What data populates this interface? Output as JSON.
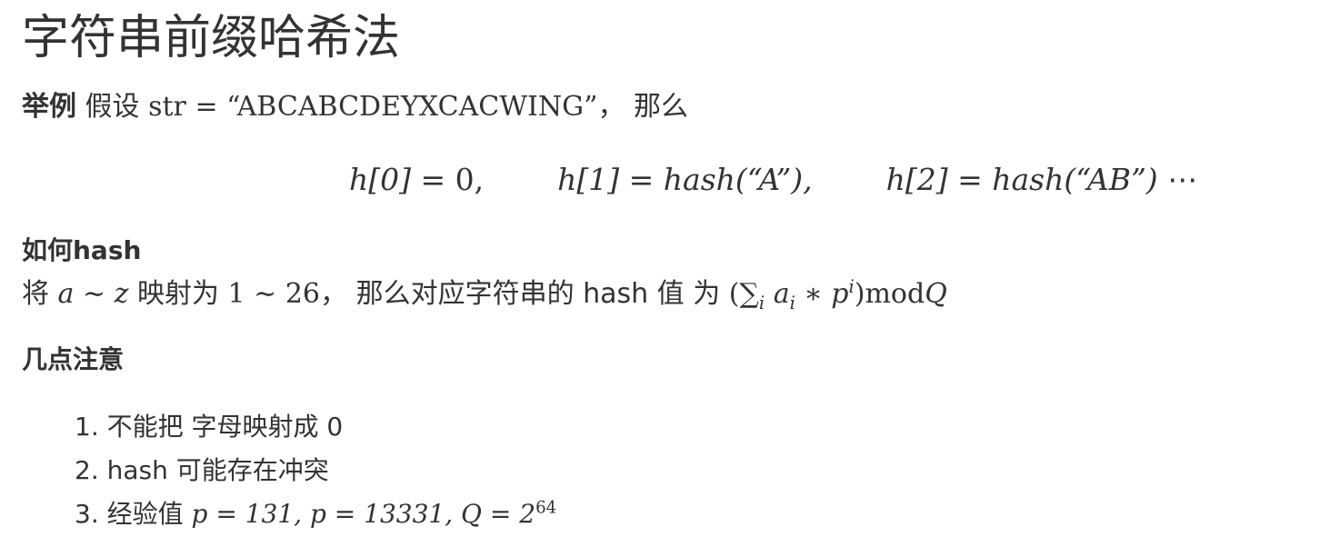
{
  "title": "字符串前缀哈希法",
  "example": {
    "label": "举例",
    "prefix": "假设",
    "var": "str",
    "eq": "=",
    "value": "“ABCABCDEYXCACWING”",
    "suffix": "， 那么"
  },
  "display_math": {
    "h0_lhs": "h[0]",
    "h0_rhs": "= 0,",
    "h1_lhs": "h[1]",
    "h1_rhs": "= hash(“A”),",
    "h2_lhs": "h[2]",
    "h2_rhs": "= hash(“AB”)",
    "dots": "⋯"
  },
  "how_hash": {
    "heading": "如何hash",
    "jiang": "将",
    "range_letters": "a ∼ z",
    "map_to": "映射为",
    "range_nums": "1 ∼ 26",
    "text_mid": "， 那么对应字符串的 hash 值 为",
    "formula_open": "(",
    "sum": "∑",
    "sum_sub": "i",
    "a": "a",
    "a_sub": "i",
    "times_p": " ∗ p",
    "p_sup": "i",
    "formula_close": ")",
    "mod": "mod",
    "Q": "Q"
  },
  "notes": {
    "heading": "几点注意",
    "items": [
      {
        "num": "1.",
        "text": "不能把 字母映射成 0"
      },
      {
        "num": "2.",
        "text": "hash 可能存在冲突"
      },
      {
        "num": "3.",
        "text": "经验值",
        "math1": "p = 131, p = 13331, Q = 2",
        "math_sup": "64"
      }
    ]
  }
}
